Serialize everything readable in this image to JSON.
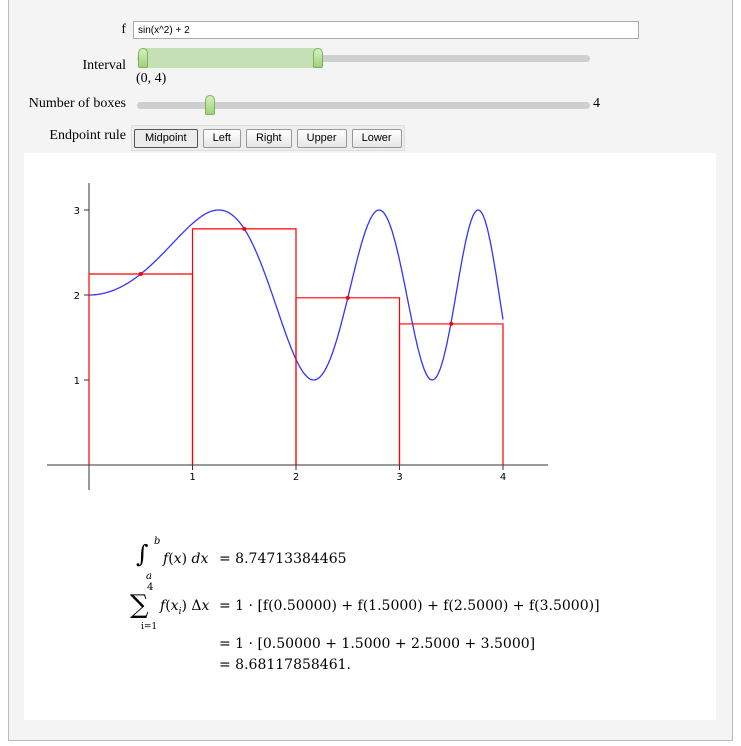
{
  "controls": {
    "f_label": "f",
    "f_value": "sin(x^2) + 2",
    "interval_label": "Interval",
    "interval_value": "(0, 4)",
    "interval_range": [
      0,
      4
    ],
    "boxes_label": "Number of boxes",
    "boxes_value": "4",
    "endpoint_label": "Endpoint rule",
    "endpoint_buttons": [
      "Midpoint",
      "Left",
      "Right",
      "Upper",
      "Lower"
    ],
    "endpoint_selected": "Midpoint"
  },
  "colors": {
    "curve": "#3333ff",
    "boxes": "#ff0000",
    "slider_handle": "#9fd27a",
    "slider_range": "#c5e0b4"
  },
  "chart_data": {
    "type": "line",
    "function": "sin(x^2) + 2",
    "xlim": [
      0,
      4
    ],
    "ylim": [
      0,
      3.2
    ],
    "xticks": [
      "1",
      "2",
      "3",
      "4"
    ],
    "yticks": [
      "1",
      "2",
      "3"
    ],
    "rectangles": [
      {
        "x0": 0,
        "x1": 1,
        "height": 2.2474,
        "sample_x": 0.5
      },
      {
        "x0": 1,
        "x1": 2,
        "height": 2.7781,
        "sample_x": 1.5
      },
      {
        "x0": 2,
        "x1": 3,
        "height": 1.9668,
        "sample_x": 2.5
      },
      {
        "x0": 3,
        "x1": 4,
        "height": 1.6597,
        "sample_x": 3.5
      }
    ]
  },
  "results": {
    "integral_value": "= 8.74713384465",
    "sum_upper": "4",
    "sum_lower": "i=1",
    "line1": "= 1 · [f(0.50000) + f(1.5000) + f(2.5000) + f(3.5000)]",
    "line2": "= 1 · [0.50000 + 1.5000 + 2.5000 + 3.5000]",
    "line3": "= 8.68117858461."
  }
}
